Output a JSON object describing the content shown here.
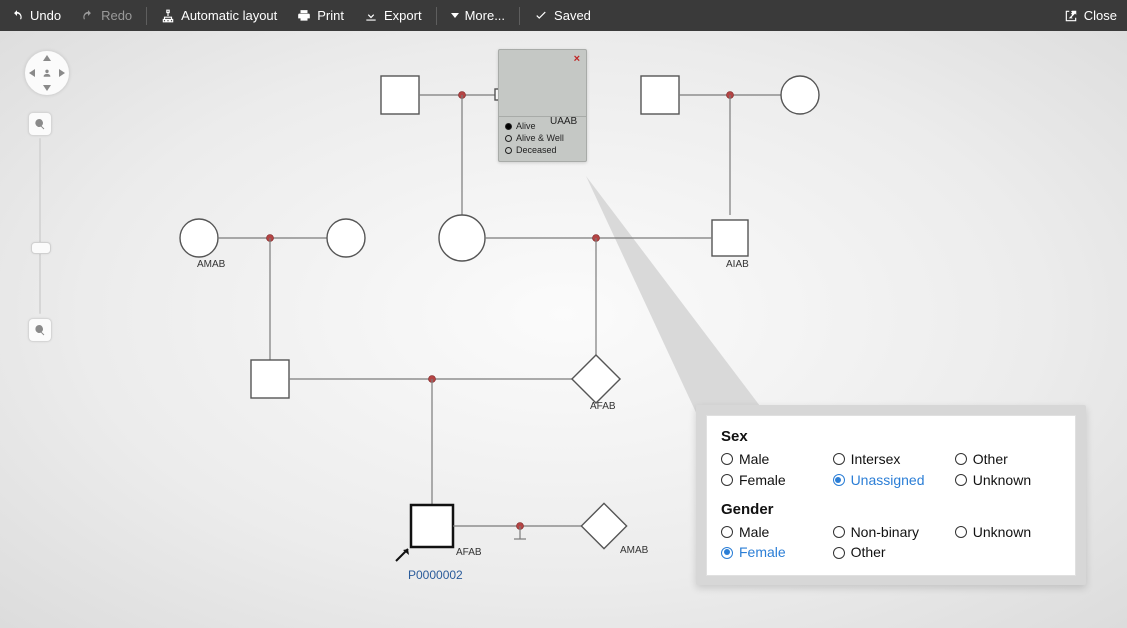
{
  "toolbar": {
    "undo": "Undo",
    "redo": "Redo",
    "auto_layout": "Automatic layout",
    "print": "Print",
    "export": "Export",
    "more": "More...",
    "saved": "Saved",
    "close": "Close"
  },
  "nodes": {
    "gen1_selected_label": "UAAB",
    "gen2_left_label": "AMAB",
    "gen2_right_label": "AIAB",
    "gen3_diamond_label": "AFAB",
    "gen4_proband_label": "AFAB",
    "gen4_spouse_label": "AMAB",
    "proband_id": "P0000002"
  },
  "node_popup": {
    "opt_alive": "Alive",
    "opt_alive_well": "Alive & Well",
    "opt_deceased": "Deceased",
    "selected": "Alive"
  },
  "panel": {
    "sex_heading": "Sex",
    "gender_heading": "Gender",
    "sex_options": [
      "Male",
      "Female",
      "Intersex",
      "Unassigned",
      "Other",
      "Unknown"
    ],
    "sex_selected": "Unassigned",
    "gender_options": [
      "Male",
      "Female",
      "Non-binary",
      "Other",
      "Unknown"
    ],
    "gender_selected": "Female"
  }
}
